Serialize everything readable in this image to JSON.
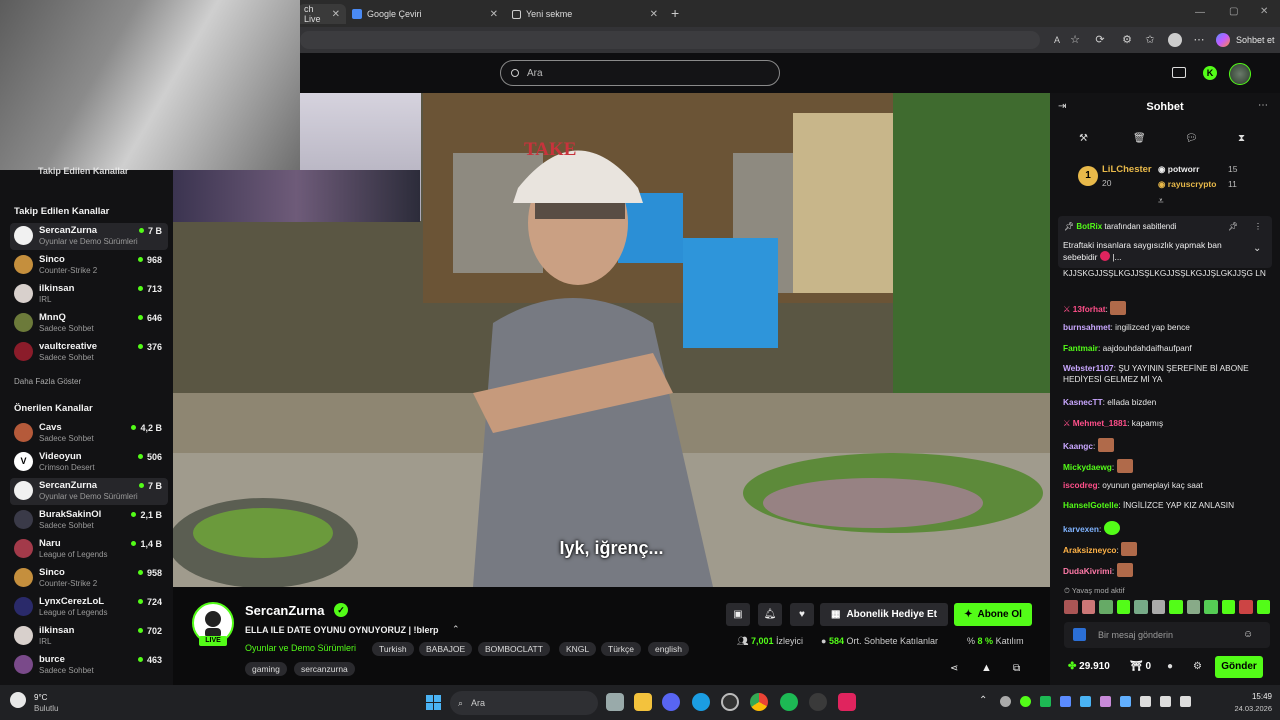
{
  "browser": {
    "tabs": [
      {
        "label": "ch Live"
      },
      {
        "label": "Google Çeviri"
      },
      {
        "label": "Yeni sekme"
      }
    ],
    "chat_button_label": "Sohbet et"
  },
  "header": {
    "search_placeholder": "Ara"
  },
  "sidebar": {
    "followed_overlay_title": "Takip Edilen Kanallar",
    "followed_title": "Takip Edilen Kanallar",
    "followed": [
      {
        "name": "SercanZurna",
        "category": "Oyunlar ve Demo Sürümleri",
        "viewers": "7 B",
        "selected": true
      },
      {
        "name": "Sinco",
        "category": "Counter-Strike 2",
        "viewers": "968"
      },
      {
        "name": "ilkinsan",
        "category": "IRL",
        "viewers": "713"
      },
      {
        "name": "MnnQ",
        "category": "Sadece Sohbet",
        "viewers": "646"
      },
      {
        "name": "vaultcreative",
        "category": "Sadece Sohbet",
        "viewers": "376"
      }
    ],
    "show_more": "Daha Fazla Göster",
    "recommended_title": "Önerilen Kanallar",
    "recommended": [
      {
        "name": "Cavs",
        "category": "Sadece Sohbet",
        "viewers": "4,2 B"
      },
      {
        "name": "Videoyun",
        "category": "Crimson Desert",
        "viewers": "506"
      },
      {
        "name": "SercanZurna",
        "category": "Oyunlar ve Demo Sürümleri",
        "viewers": "7 B",
        "selected": true
      },
      {
        "name": "BurakSakinOl",
        "category": "Sadece Sohbet",
        "viewers": "2,1 B"
      },
      {
        "name": "Naru",
        "category": "League of Legends",
        "viewers": "1,4 B"
      },
      {
        "name": "Sinco",
        "category": "Counter-Strike 2",
        "viewers": "958"
      },
      {
        "name": "LynxCerezLoL",
        "category": "League of Legends",
        "viewers": "724"
      },
      {
        "name": "ilkinsan",
        "category": "IRL",
        "viewers": "702"
      },
      {
        "name": "burce",
        "category": "Sadece Sohbet",
        "viewers": "463"
      }
    ]
  },
  "video": {
    "subtitle": "Iyk, iğrenç...",
    "cap_text": "TAKE"
  },
  "stream": {
    "streamer": "SercanZurna",
    "live_label": "LIVE",
    "title": "ELLA ILE DATE OYUNU OYNUYORUZ | !blerp",
    "category": "Oyunlar ve Demo Sürümleri",
    "tags": [
      "Turkish",
      "BABAJOE",
      "BOMBOCLATT",
      "KNGL",
      "Türkçe",
      "english",
      "gaming",
      "sercanzurna"
    ],
    "gift_label": "Abonelik Hediye Et",
    "subscribe_label": "Abone Ol",
    "viewers_value": "7,001",
    "viewers_label": "İzleyici",
    "chatters_value": "584",
    "chatters_label": "Ort. Sohbete Katılanlar",
    "participation_value": "8 %",
    "participation_label": "Katılım"
  },
  "chat": {
    "title": "Sohbet",
    "leaderboard": [
      {
        "name": "LiLChester",
        "value": "20",
        "rank": "1"
      },
      {
        "name": "potworr",
        "value": "15"
      },
      {
        "name": "rayuscrypto",
        "value": "11"
      }
    ],
    "pinned": {
      "by_user": "BotRix",
      "by_label": "tarafından sabitlendi",
      "text": "Etraftaki insanlara saygısızlık yapmak ban sebebidir",
      "trail": "|..."
    },
    "messages": [
      {
        "user": "",
        "text": "KJJSKGJJSŞLKGJJSŞLKGJJSŞLKGJJŞLGKJJŞG LN",
        "color": "#e8e8e8"
      },
      {
        "user": "13forhat",
        "text": "",
        "color": "#ff4f8a",
        "emote": true
      },
      {
        "user": "burnsahmet",
        "text": "ingilizced yap bence",
        "color": "#c9a7ff"
      },
      {
        "user": "Fantmair",
        "text": "aajdouhdahdaifhaufpanf",
        "color": "#53fc18"
      },
      {
        "user": "Webster1107",
        "text": "ŞU YAYININ ŞEREFİNE Bİ ABONE HEDİYESİ GELMEZ Mİ YA",
        "color": "#c9a7ff"
      },
      {
        "user": "KasnecTT",
        "text": "ellada bizden",
        "color": "#c9a7ff"
      },
      {
        "user": "Mehmet_1881",
        "text": "kapamış",
        "color": "#ff4f8a"
      },
      {
        "user": "Kaangc",
        "text": "",
        "color": "#c9a7ff",
        "emote": true
      },
      {
        "user": "Mickydaewg",
        "text": "",
        "color": "#53fc18",
        "emote": true
      },
      {
        "user": "iscodreg",
        "text": "oyunun gameplayi kaç saat",
        "color": "#ff4f8a"
      },
      {
        "user": "HanselGotelle",
        "text": "İNGİLİZCE YAP KIZ ANLASIN",
        "color": "#53fc18"
      },
      {
        "user": "karvexen",
        "text": "",
        "color": "#7fb3ff",
        "emote": true,
        "green_emote": true
      },
      {
        "user": "Araksizneyco",
        "text": "",
        "color": "#ffb347",
        "emote": true
      },
      {
        "user": "DudaKivrimi",
        "text": "",
        "color": "#ff7aa8",
        "emote": true
      }
    ],
    "slow_mode": "Yavaş mod aktif",
    "input_placeholder": "Bir mesaj gönderin",
    "points": "29.910",
    "gift_count": "0",
    "send_label": "Gönder"
  },
  "taskbar": {
    "weather_temp": "9°C",
    "weather_desc": "Bulutlu",
    "search_label": "Ara",
    "time": "15:49",
    "date": "24.03.2026"
  },
  "colors": {
    "accent": "#53fc18",
    "background": "#0b0b0c",
    "panel": "#121214"
  }
}
